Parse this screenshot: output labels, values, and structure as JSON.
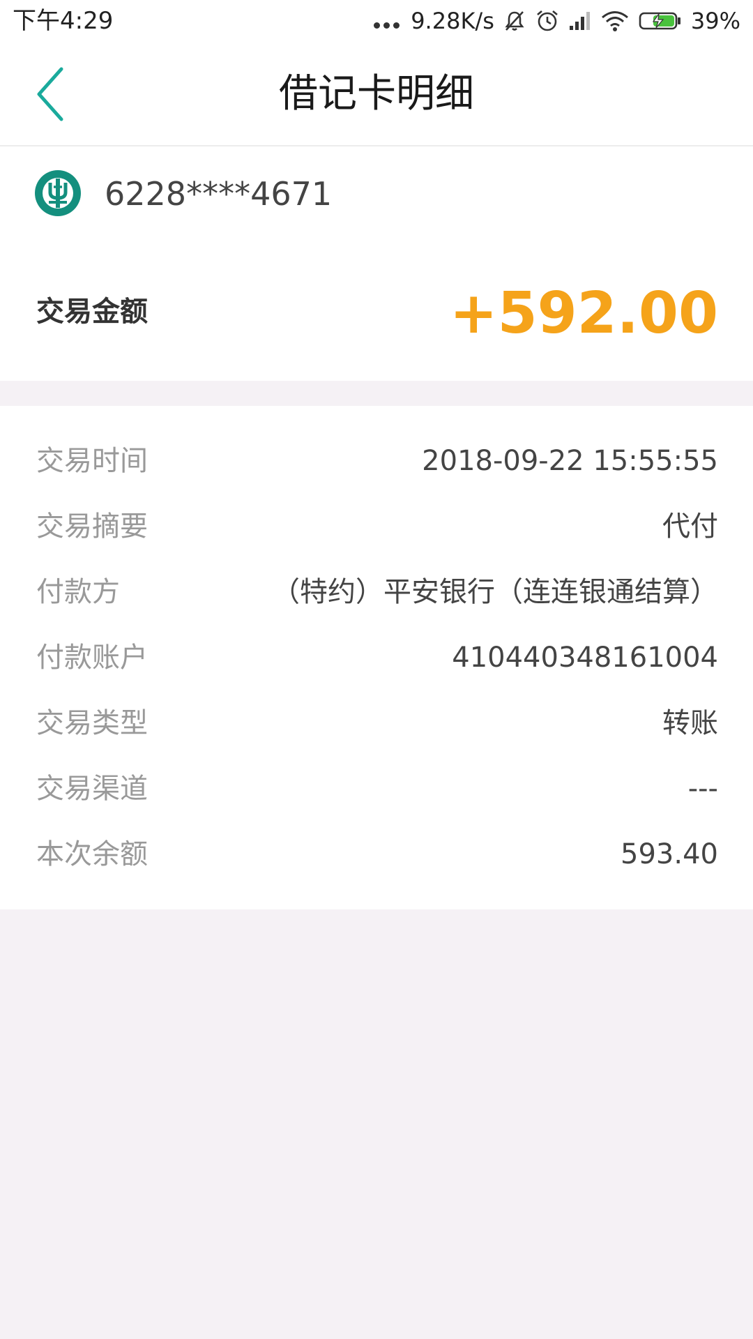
{
  "status_bar": {
    "time": "下午4:29",
    "network_speed": "9.28K/s",
    "battery_percent": "39%",
    "icons": [
      "more-dots-icon",
      "mute-icon",
      "alarm-icon",
      "signal-icon",
      "wifi-icon",
      "battery-charging-icon"
    ]
  },
  "header": {
    "title": "借记卡明细",
    "back_icon": "chevron-left-icon"
  },
  "card": {
    "bank_logo_icon": "bank-logo-icon",
    "number": "6228****4671"
  },
  "amount": {
    "label": "交易金额",
    "value": "+592.00",
    "color": "#f5a31a"
  },
  "details": {
    "rows": [
      {
        "label": "交易时间",
        "value": "2018-09-22 15:55:55"
      },
      {
        "label": "交易摘要",
        "value": "代付"
      },
      {
        "label": "付款方",
        "value": "（特约）平安银行（连连银通结算）"
      },
      {
        "label": "付款账户",
        "value": "410440348161004"
      },
      {
        "label": "交易类型",
        "value": "转账"
      },
      {
        "label": "交易渠道",
        "value": "---"
      },
      {
        "label": "本次余额",
        "value": "593.40"
      }
    ]
  },
  "colors": {
    "accent": "#1aaa9c",
    "amount": "#f5a31a",
    "background": "#f5f1f5"
  }
}
